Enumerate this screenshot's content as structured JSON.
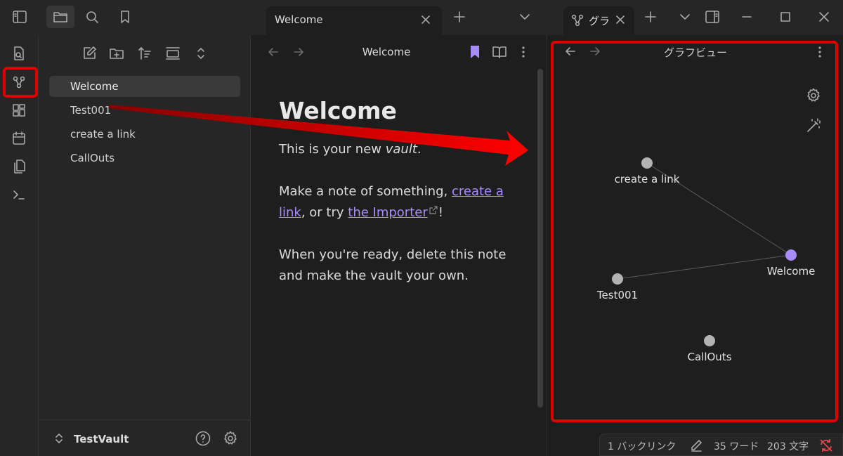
{
  "tabs": {
    "welcome_title": "Welcome",
    "graph_title": "グラフビュー"
  },
  "sidebar": {
    "files": [
      {
        "label": "Welcome",
        "active": true
      },
      {
        "label": "Test001",
        "active": false
      },
      {
        "label": "create a link",
        "active": false
      },
      {
        "label": "CallOuts",
        "active": false
      }
    ],
    "vault_name": "TestVault"
  },
  "editor": {
    "header_title": "Welcome",
    "heading": "Welcome",
    "p1_prefix": "This is your new ",
    "p1_em": "vault",
    "p1_suffix": ".",
    "p2_prefix": "Make a note of something, ",
    "p2_link1": "create a link",
    "p2_mid": ", or try ",
    "p2_link2": "the Importer",
    "p2_suffix": "!",
    "p3": "When you're ready, delete this note and make the vault your own."
  },
  "graph": {
    "header_title": "グラフビュー",
    "nodes": [
      {
        "label": "create a link",
        "color": "#b3b3b3"
      },
      {
        "label": "Welcome",
        "color": "#a88bfa"
      },
      {
        "label": "Test001",
        "color": "#b3b3b3"
      },
      {
        "label": "CallOuts",
        "color": "#b3b3b3"
      }
    ]
  },
  "status": {
    "backlinks": "1 バックリンク",
    "words": "35 ワード",
    "chars": "203 文字"
  },
  "colors": {
    "accent": "#a88bfa",
    "annotation_red": "#e00000",
    "sync_icon": "#e5484d"
  }
}
